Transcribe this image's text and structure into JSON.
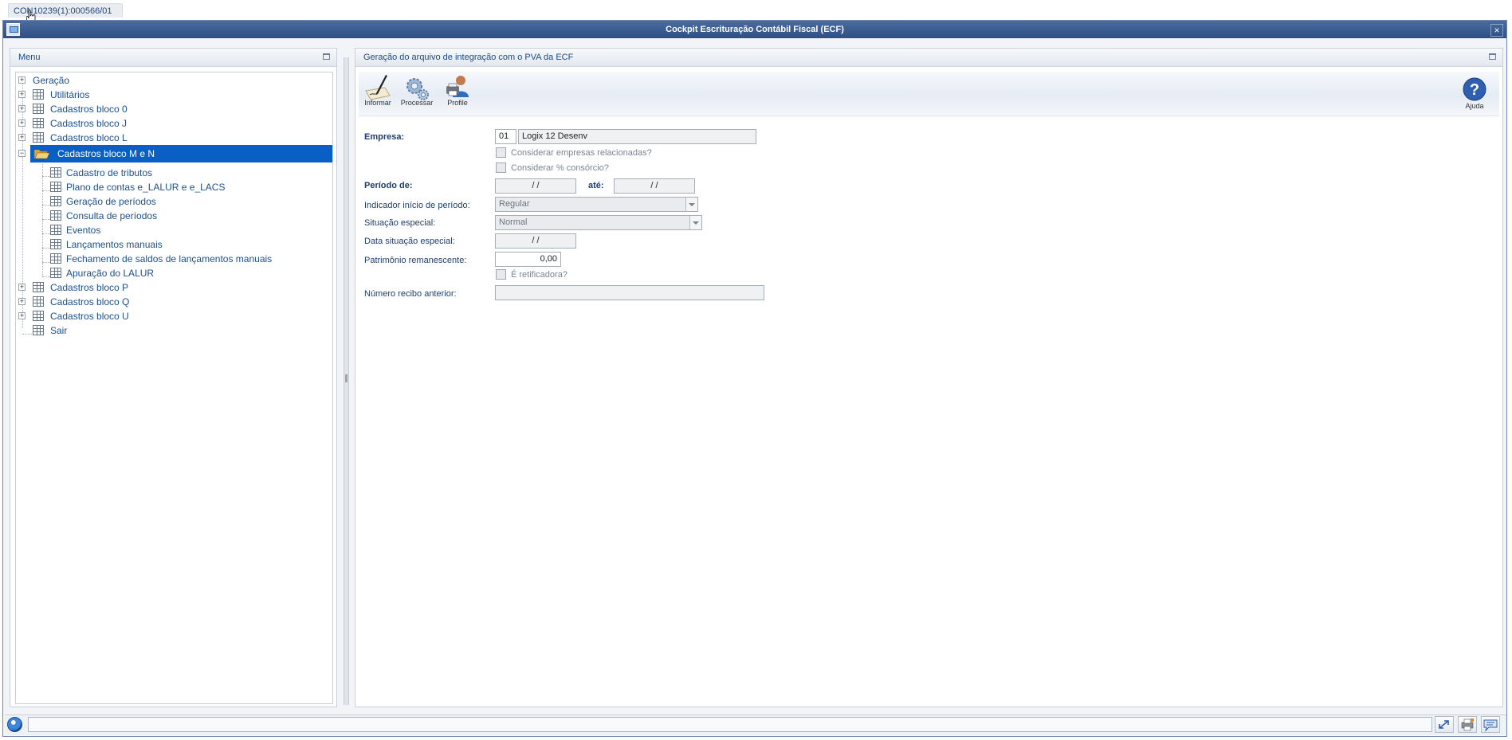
{
  "doc_tab": {
    "label": "CON10239(1):000566/01"
  },
  "window": {
    "title": "Cockpit Escrituração Contábil Fiscal (ECF)",
    "close_glyph": "×"
  },
  "menu": {
    "header": "Menu",
    "items": [
      {
        "label": "Geração",
        "level": 0,
        "icon": "none"
      },
      {
        "label": "Utilitários",
        "level": 0,
        "icon": "grid-icon"
      },
      {
        "label": "Cadastros bloco 0",
        "level": 0,
        "icon": "grid-icon"
      },
      {
        "label": "Cadastros bloco J",
        "level": 0,
        "icon": "grid-icon"
      },
      {
        "label": "Cadastros bloco L",
        "level": 0,
        "icon": "grid-icon"
      },
      {
        "label": "Cadastros bloco M e N",
        "level": 0,
        "icon": "folder-open-icon",
        "selected": true
      },
      {
        "label": "Cadastro de tributos",
        "level": 1,
        "icon": "grid-icon"
      },
      {
        "label": "Plano de contas e_LALUR e e_LACS",
        "level": 1,
        "icon": "grid-icon"
      },
      {
        "label": "Geração de períodos",
        "level": 1,
        "icon": "grid-icon"
      },
      {
        "label": "Consulta de períodos",
        "level": 1,
        "icon": "grid-icon"
      },
      {
        "label": "Eventos",
        "level": 1,
        "icon": "grid-icon"
      },
      {
        "label": "Lançamentos manuais",
        "level": 1,
        "icon": "grid-icon"
      },
      {
        "label": "Fechamento de saldos de lançamentos manuais",
        "level": 1,
        "icon": "grid-icon"
      },
      {
        "label": "Apuração do LALUR",
        "level": 1,
        "icon": "grid-icon"
      },
      {
        "label": "Cadastros bloco P",
        "level": 0,
        "icon": "grid-icon"
      },
      {
        "label": "Cadastros bloco Q",
        "level": 0,
        "icon": "grid-icon"
      },
      {
        "label": "Cadastros bloco U",
        "level": 0,
        "icon": "grid-icon"
      },
      {
        "label": "Sair",
        "level": 0,
        "icon": "grid-icon"
      }
    ]
  },
  "content": {
    "header": "Geração do arquivo de integração com o PVA da ECF",
    "toolbar": {
      "informar": "Informar",
      "processar": "Processar",
      "profile": "Profile",
      "ajuda": "Ajuda"
    },
    "form": {
      "empresa_label": "Empresa:",
      "empresa_code": "01",
      "empresa_name": "Logix 12 Desenv",
      "considerar_empresas_label": "Considerar empresas relacionadas?",
      "considerar_consorcio_label": "Considerar % consórcio?",
      "periodo_de_label": "Período de:",
      "periodo_de_value": "/ /",
      "ate_label": "até:",
      "ate_value": "/ /",
      "indicador_label": "Indicador início de período:",
      "indicador_value": "Regular",
      "situacao_label": "Situação especial:",
      "situacao_value": "Normal",
      "data_situacao_label": "Data situação especial:",
      "data_situacao_value": "/ /",
      "patrimonio_label": "Patrimônio remanescente:",
      "patrimonio_value": "0,00",
      "retificadora_label": "É retificadora?",
      "numero_recibo_label": "Número recibo anterior:",
      "numero_recibo_value": ""
    }
  }
}
